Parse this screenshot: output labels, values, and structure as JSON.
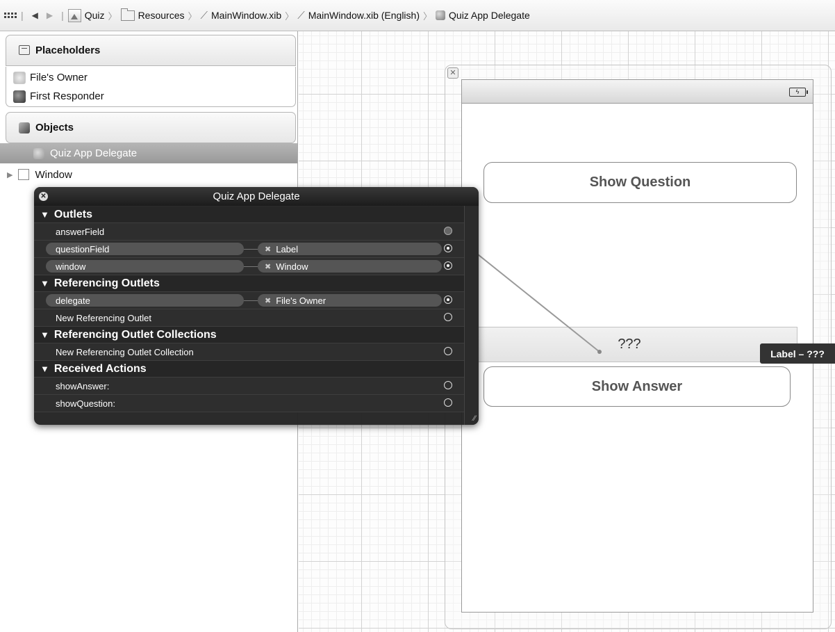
{
  "jumpbar": {
    "crumbs": [
      "Quiz",
      "Resources",
      "MainWindow.xib",
      "MainWindow.xib (English)",
      "Quiz App Delegate"
    ]
  },
  "outline": {
    "placeholders_title": "Placeholders",
    "placeholders": [
      "File's Owner",
      "First Responder"
    ],
    "objects_title": "Objects",
    "selected_object": "Quiz App Delegate",
    "window_item": "Window"
  },
  "canvas": {
    "show_question": "Show Question",
    "question_label": "???",
    "show_answer": "Show Answer",
    "tooltip": "Label – ???"
  },
  "hud": {
    "title": "Quiz App Delegate",
    "outlets_title": "Outlets",
    "outlets": [
      {
        "name": "answerField",
        "target": ""
      },
      {
        "name": "questionField",
        "target": "Label"
      },
      {
        "name": "window",
        "target": "Window"
      }
    ],
    "ref_outlets_title": "Referencing Outlets",
    "ref_outlets": [
      {
        "name": "delegate",
        "target": "File's Owner"
      },
      {
        "name": "New Referencing Outlet",
        "target": ""
      }
    ],
    "ref_collections_title": "Referencing Outlet Collections",
    "ref_collections": [
      {
        "name": "New Referencing Outlet Collection"
      }
    ],
    "actions_title": "Received Actions",
    "actions": [
      {
        "name": "showAnswer:"
      },
      {
        "name": "showQuestion:"
      }
    ]
  },
  "colors": {
    "hud_bg": "#222222",
    "selection": "#a8a8a8"
  }
}
